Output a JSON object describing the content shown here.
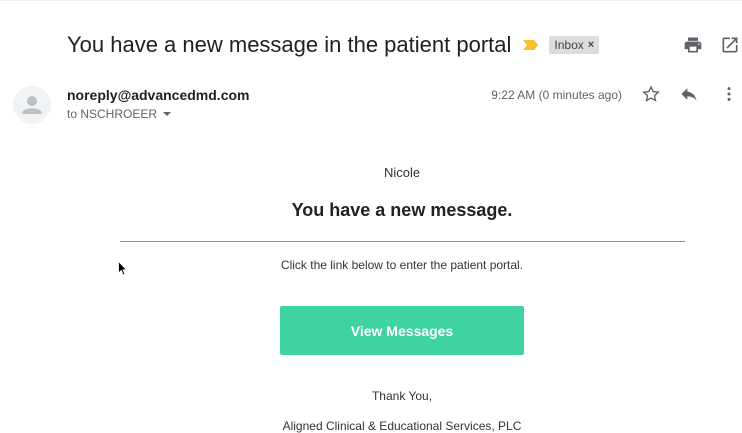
{
  "header": {
    "subject": "You have a new message in the patient portal",
    "label": "Inbox",
    "label_remove": "×",
    "importance_color": "#f6c026"
  },
  "message": {
    "sender": "noreply@advancedmd.com",
    "recipient": "to NSCHROEER",
    "time": "9:22 AM (0 minutes ago)"
  },
  "body": {
    "greeting": "Nicole",
    "headline": "You have a new message.",
    "instruction": "Click the link below to enter the patient portal.",
    "button_label": "View Messages",
    "button_color": "#3fd3a2",
    "thanks": "Thank You,",
    "organization": "Aligned Clinical & Educational Services, PLC"
  },
  "icons": {
    "print": "print-icon",
    "open_new_window": "open-in-new-window-icon",
    "avatar": "default-avatar-icon",
    "star": "star-icon",
    "reply": "reply-icon",
    "more": "more-vert-icon",
    "importance": "importance-marker-icon",
    "cursor": "mouse-cursor-icon"
  }
}
